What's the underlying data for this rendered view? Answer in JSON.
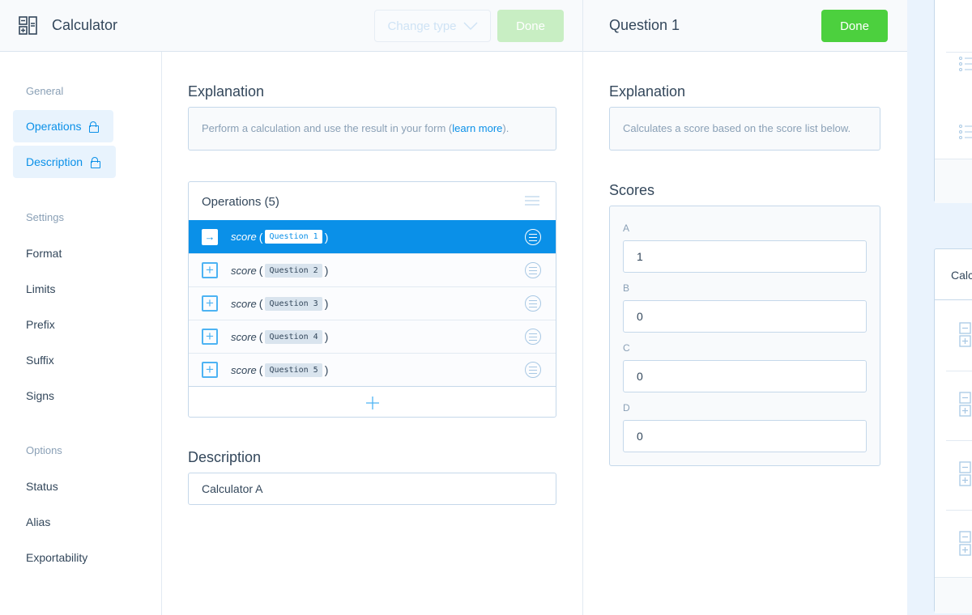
{
  "header": {
    "title": "Calculator",
    "change_type": "Change type",
    "done": "Done",
    "icon": "calculator-icon"
  },
  "sidebar": {
    "sections": [
      {
        "label": "General",
        "items": [
          {
            "label": "Operations",
            "locked": true,
            "selected": true
          },
          {
            "label": "Description",
            "locked": true,
            "selected": true
          }
        ]
      },
      {
        "label": "Settings",
        "items": [
          {
            "label": "Format"
          },
          {
            "label": "Limits"
          },
          {
            "label": "Prefix"
          },
          {
            "label": "Suffix"
          },
          {
            "label": "Signs"
          }
        ]
      },
      {
        "label": "Options",
        "items": [
          {
            "label": "Status"
          },
          {
            "label": "Alias"
          },
          {
            "label": "Exportability"
          }
        ]
      }
    ]
  },
  "main": {
    "explanation_title": "Explanation",
    "explanation_text": "Perform a calculation and use the result in your form (",
    "learn_more": "learn more",
    "explanation_end": ").",
    "operations_title": "Operations (5)",
    "operations": [
      {
        "fn": "score",
        "arg": "Question 1",
        "selected": true
      },
      {
        "fn": "score",
        "arg": "Question 2"
      },
      {
        "fn": "score",
        "arg": "Question 3"
      },
      {
        "fn": "score",
        "arg": "Question 4"
      },
      {
        "fn": "score",
        "arg": "Question 5"
      }
    ],
    "description_title": "Description",
    "description_value": "Calculator A"
  },
  "question": {
    "title": "Question 1",
    "done": "Done",
    "explanation_title": "Explanation",
    "explanation_text": "Calculates a score based on the score list below.",
    "scores_title": "Scores",
    "scores": [
      {
        "label": "A",
        "value": "1"
      },
      {
        "label": "B",
        "value": "0"
      },
      {
        "label": "C",
        "value": "0"
      },
      {
        "label": "D",
        "value": "0"
      }
    ]
  },
  "far_right": {
    "card_title": "Calc"
  },
  "colors": {
    "accent": "#0a90e8",
    "done": "#4cd03e",
    "done_disabled": "#c8eec3",
    "bg_side": "#eaf3fd"
  }
}
